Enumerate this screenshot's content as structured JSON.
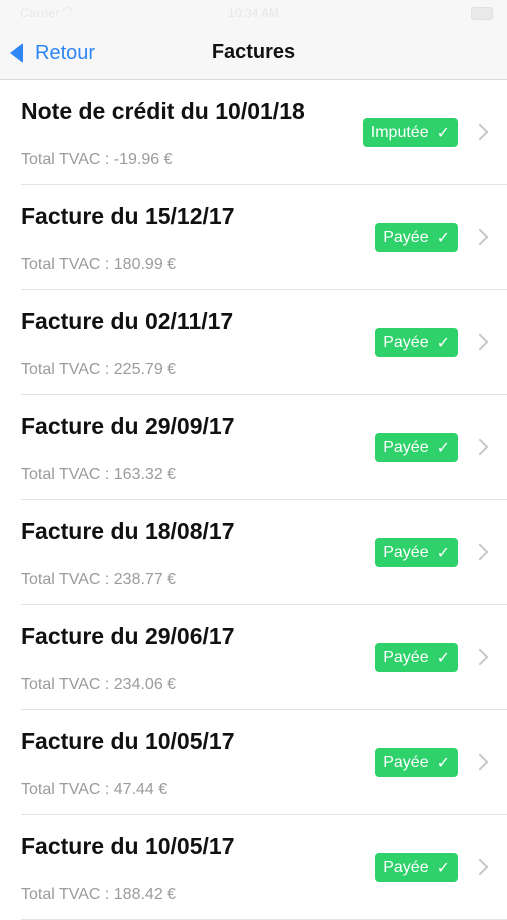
{
  "status_bar": {
    "carrier": "Carrier",
    "time": "10:34 AM"
  },
  "nav": {
    "back_label": "Retour",
    "title": "Factures"
  },
  "invoices": [
    {
      "title": "Note de crédit du 10/01/18",
      "total": "Total TVAC : -19.96 €",
      "status": "Imputée"
    },
    {
      "title": "Facture du 15/12/17",
      "total": "Total TVAC : 180.99 €",
      "status": "Payée"
    },
    {
      "title": "Facture du 02/11/17",
      "total": "Total TVAC : 225.79 €",
      "status": "Payée"
    },
    {
      "title": "Facture du 29/09/17",
      "total": "Total TVAC : 163.32 €",
      "status": "Payée"
    },
    {
      "title": "Facture du 18/08/17",
      "total": "Total TVAC : 238.77 €",
      "status": "Payée"
    },
    {
      "title": "Facture du 29/06/17",
      "total": "Total TVAC : 234.06 €",
      "status": "Payée"
    },
    {
      "title": "Facture du 10/05/17",
      "total": "Total TVAC : 47.44 €",
      "status": "Payée"
    },
    {
      "title": "Facture du 10/05/17",
      "total": "Total TVAC : 188.42 €",
      "status": "Payée"
    }
  ],
  "colors": {
    "accent": "#2f86f6",
    "badge_green": "#2fd16a"
  },
  "icons": {
    "back": "chevron-left-icon",
    "badge": "checkmark-icon",
    "row": "chevron-right-icon"
  }
}
